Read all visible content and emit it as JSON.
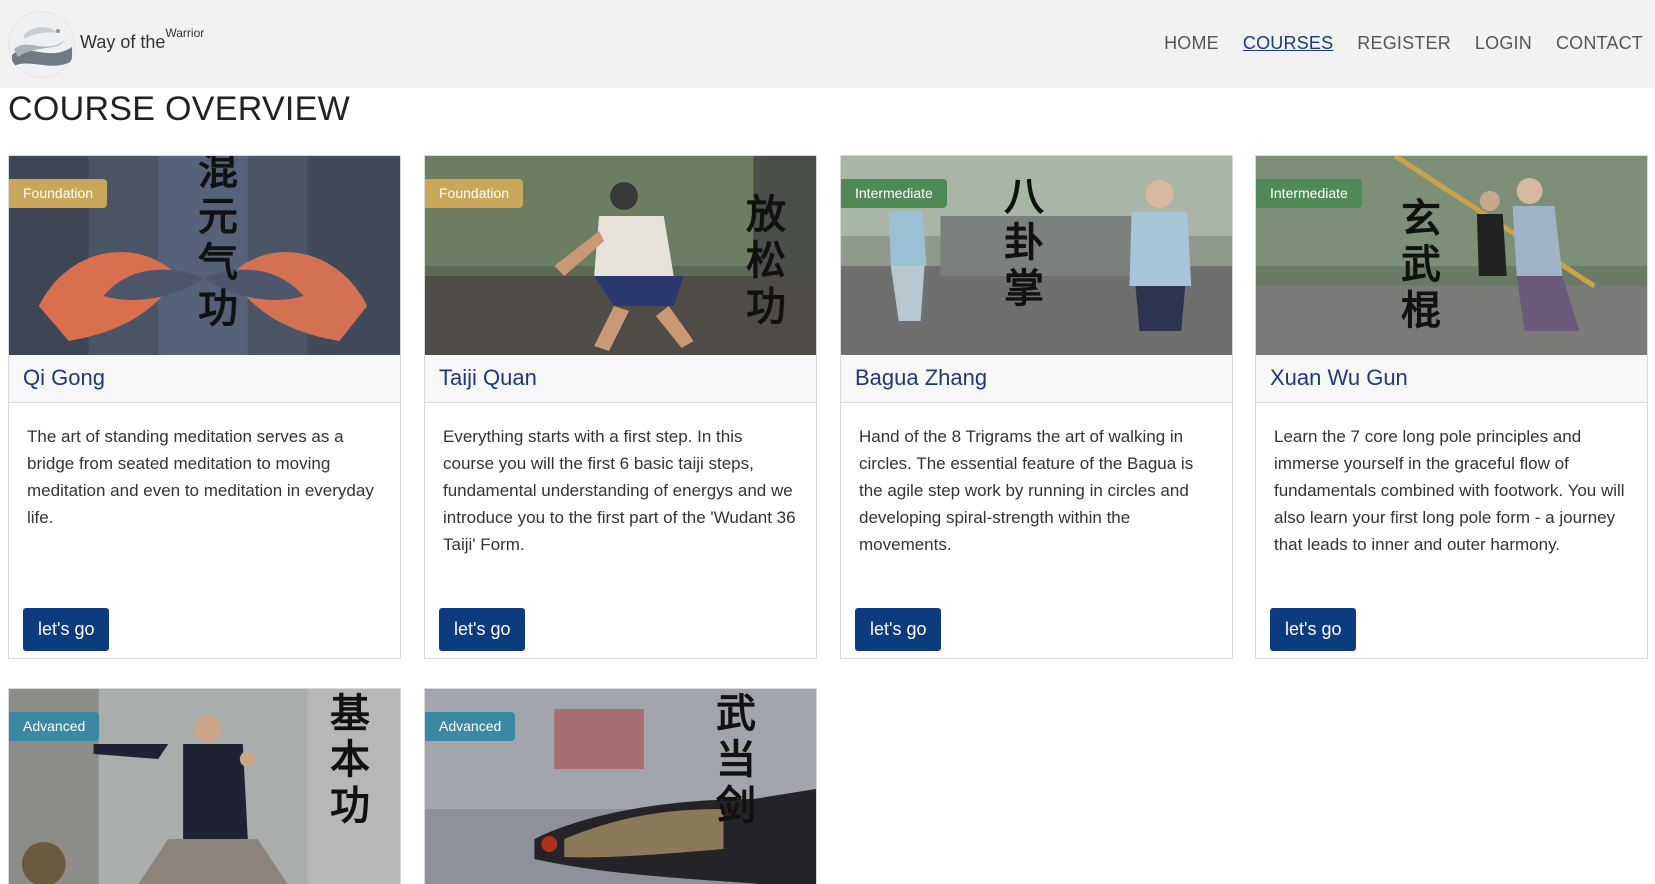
{
  "brand": {
    "name": "Way of the",
    "super": "Warrior"
  },
  "nav": {
    "home": "HOME",
    "courses": "COURSES",
    "register": "REGISTER",
    "login": "LOGIN",
    "contact": "CONTACT"
  },
  "page_title": "COURSE OVERVIEW",
  "colors": {
    "accent": "#0d3b7f",
    "title_blue": "#1b3a78",
    "foundation": "#c9a65a",
    "intermediate": "#4f8a56",
    "advanced": "#3b88a5"
  },
  "cards": [
    {
      "level": "Foundation",
      "chars": "混元气功",
      "title": "Qi Gong",
      "text": "The art of standing meditation serves as a bridge from seated meditation to moving meditation and even to meditation in everyday life.",
      "button": "let's go"
    },
    {
      "level": "Foundation",
      "chars": "放松功",
      "title": "Taiji Quan",
      "text": "Everything starts with a first step. In this course you will the first 6 basic taiji steps, fundamental understanding of energys and we introduce you to the first part of the 'Wudant 36 Taiji' Form.",
      "button": "let's go"
    },
    {
      "level": "Intermediate",
      "chars": "八卦掌",
      "title": "Bagua Zhang",
      "text": "Hand of the 8 Trigrams the art of walking in circles. The essential feature of the Bagua is the agile step work by running in circles and developing spiral-strength within the movements.",
      "button": "let's go"
    },
    {
      "level": "Intermediate",
      "chars": "玄武棍",
      "title": "Xuan Wu Gun",
      "text": "Learn the 7 core long pole principles and immerse yourself in the graceful flow of fundamentals combined with footwork. You will also learn your first long pole form - a journey that leads to inner and outer harmony.",
      "button": "let's go"
    },
    {
      "level": "Advanced",
      "chars": "基本功"
    },
    {
      "level": "Advanced",
      "chars": "武当剑"
    }
  ]
}
